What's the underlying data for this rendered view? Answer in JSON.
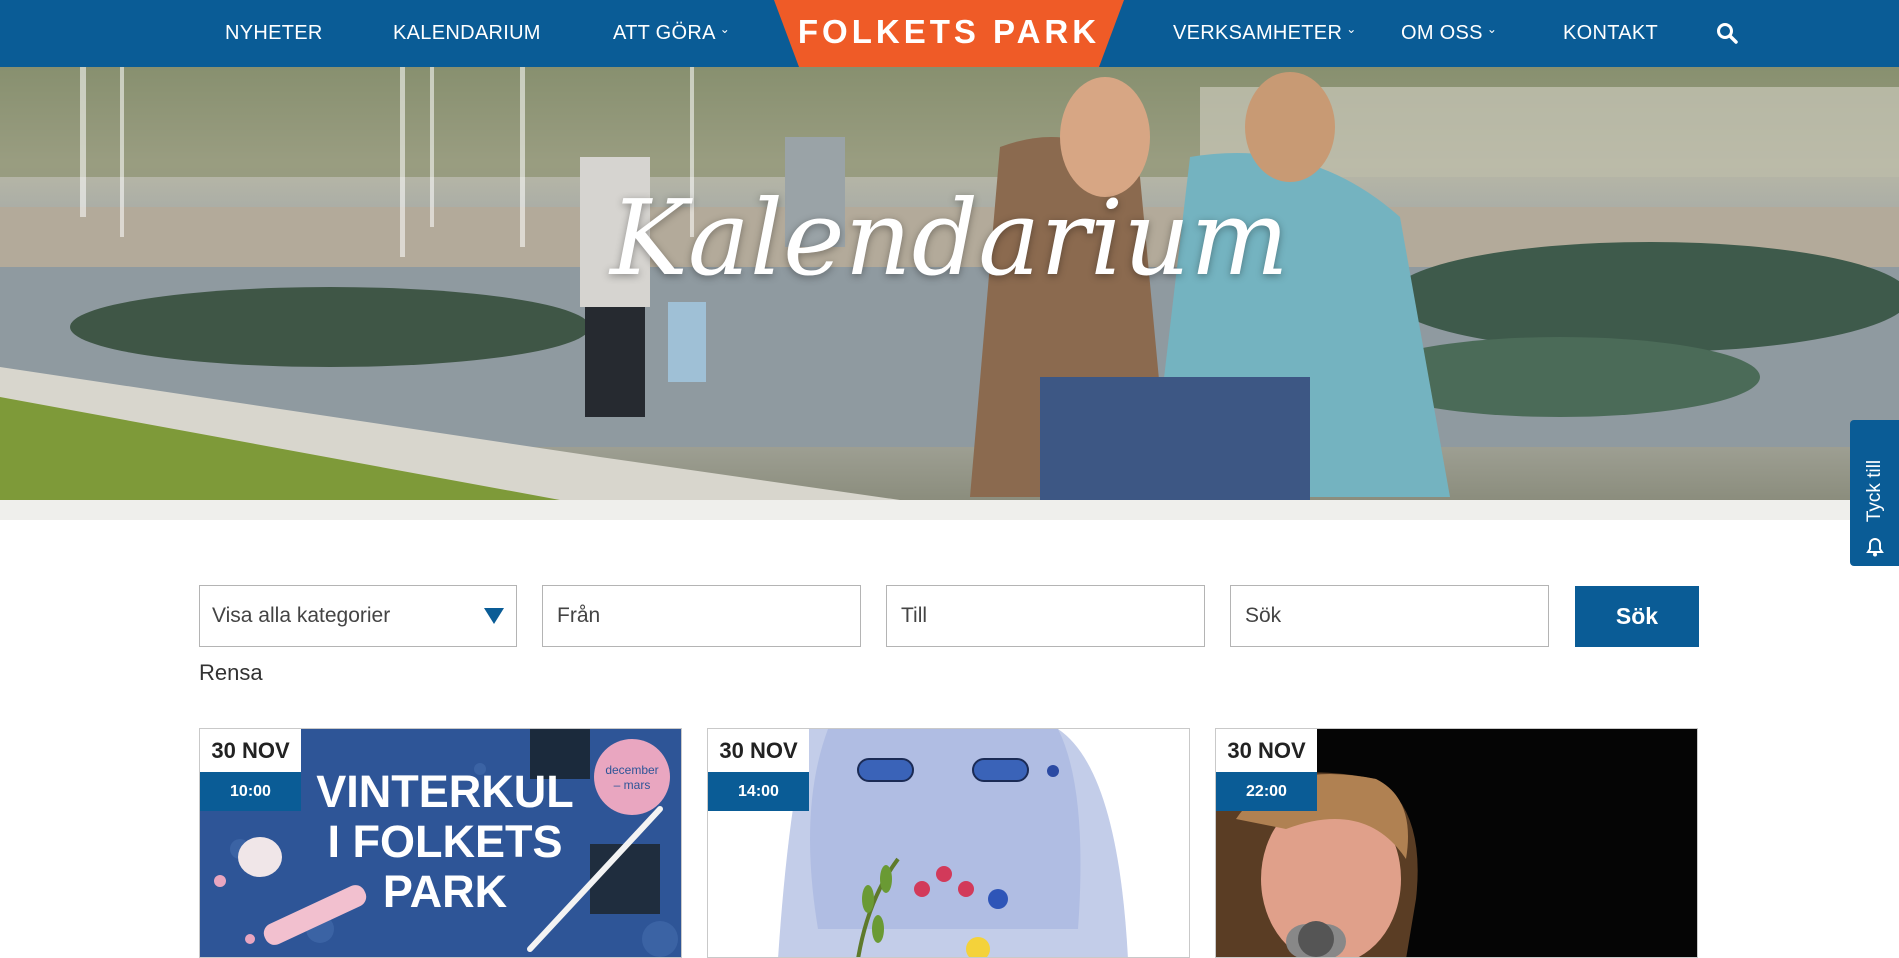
{
  "nav": {
    "items": [
      {
        "label": "NYHETER",
        "dropdown": false
      },
      {
        "label": "KALENDARIUM",
        "dropdown": false
      },
      {
        "label": "ATT GÖRA",
        "dropdown": true
      },
      {
        "label": "VERKSAMHETER",
        "dropdown": true
      },
      {
        "label": "OM OSS",
        "dropdown": true
      },
      {
        "label": "KONTAKT",
        "dropdown": false
      }
    ],
    "logo_text": "FOLKETS PARK",
    "search_icon": "search-icon"
  },
  "hero": {
    "title": "Kalendarium"
  },
  "feedback": {
    "label": "Tyck till",
    "icon": "bell-icon"
  },
  "filters": {
    "category_selected": "Visa alla kategorier",
    "from_placeholder": "Från",
    "to_placeholder": "Till",
    "search_placeholder": "Sök",
    "search_button": "Sök",
    "clear_label": "Rensa"
  },
  "events": [
    {
      "date": "30 NOV",
      "time": "10:00",
      "poster_title_lines": [
        "VINTERKUL",
        "I FOLKETS",
        "PARK"
      ],
      "poster_badge_lines": [
        "december",
        "– mars"
      ]
    },
    {
      "date": "30 NOV",
      "time": "14:00"
    },
    {
      "date": "30 NOV",
      "time": "22:00"
    }
  ],
  "colors": {
    "brand_blue": "#0a5c96",
    "logo_orange": "#ef5b27",
    "poster_blue": "#2e5597",
    "poster_pink": "#e9a6c0"
  }
}
